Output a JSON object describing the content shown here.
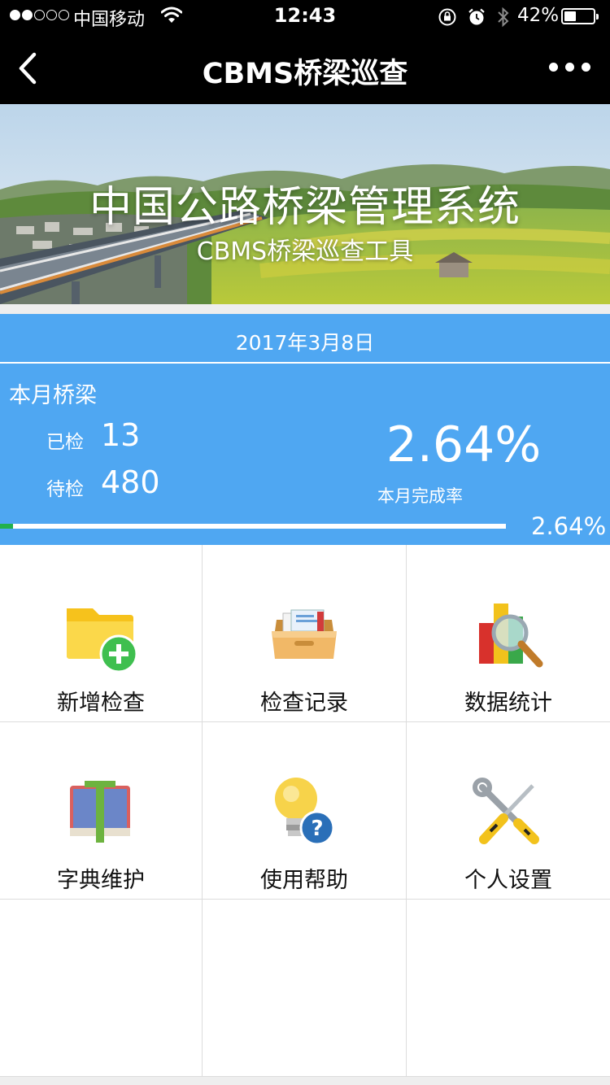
{
  "status_bar": {
    "carrier": "中国移动",
    "time": "12:43",
    "battery_pct": "42%",
    "battery_level": 0.42,
    "signal_bars": 2,
    "icons": [
      "wifi-icon",
      "rotation-lock-icon",
      "alarm-icon",
      "bluetooth-icon"
    ]
  },
  "nav": {
    "title": "CBMS桥梁巡查",
    "back_icon": "chevron-left-icon",
    "more_icon": "more-dots-icon"
  },
  "banner": {
    "title": "中国公路桥梁管理系统",
    "subtitle": "CBMS桥梁巡查工具"
  },
  "stats": {
    "date": "2017年3月8日",
    "month_label": "本月桥梁",
    "checked_label": "已检",
    "checked_value": "13",
    "pending_label": "待检",
    "pending_value": "480",
    "rate_value": "2.64%",
    "rate_label": "本月完成率",
    "progress_pct": 2.64,
    "progress_label": "2.64%",
    "accent": "#4fa7f2",
    "progress_color": "#22b14c"
  },
  "menu": [
    {
      "label": "新增检查",
      "icon": "folder-add-icon"
    },
    {
      "label": "检查记录",
      "icon": "file-box-icon"
    },
    {
      "label": "数据统计",
      "icon": "chart-magnifier-icon"
    },
    {
      "label": "字典维护",
      "icon": "books-icon"
    },
    {
      "label": "使用帮助",
      "icon": "lightbulb-help-icon"
    },
    {
      "label": "个人设置",
      "icon": "tools-icon"
    }
  ]
}
